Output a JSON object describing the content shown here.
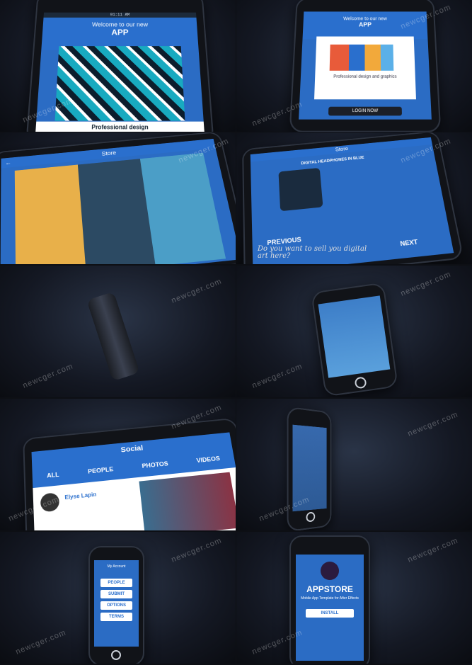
{
  "watermark": "newcger.com",
  "tiles": {
    "t1": {
      "welcome": "Welcome to our new",
      "app": "APP",
      "caption": "Professional design"
    },
    "t2": {
      "welcome": "Welcome to our new",
      "app": "APP",
      "caption": "Professional design and graphics",
      "button": "LOGIN NOW"
    },
    "t3": {
      "title": "Store"
    },
    "t4": {
      "title": "Store",
      "product": "DIGITAL HEADPHONES IN BLUE",
      "prev": "PREVIOUS",
      "next": "NEXT",
      "tagline": "Do you want to sell you digital art here?"
    },
    "t7": {
      "title": "Social",
      "tabs": [
        "ALL",
        "PEOPLE",
        "PHOTOS",
        "VIDEOS"
      ],
      "user": "Elyse Lapin"
    },
    "t9": {
      "header": "My Account",
      "items": [
        "PEOPLE",
        "SUBMIT",
        "OPTIONS",
        "TERMS"
      ]
    },
    "t10": {
      "brand": "APPSTORE",
      "subtitle": "Mobile App Template for After Effects",
      "button": "INSTALL"
    }
  },
  "colors": {
    "accent": "#2a6fcd",
    "background": "#141823"
  }
}
